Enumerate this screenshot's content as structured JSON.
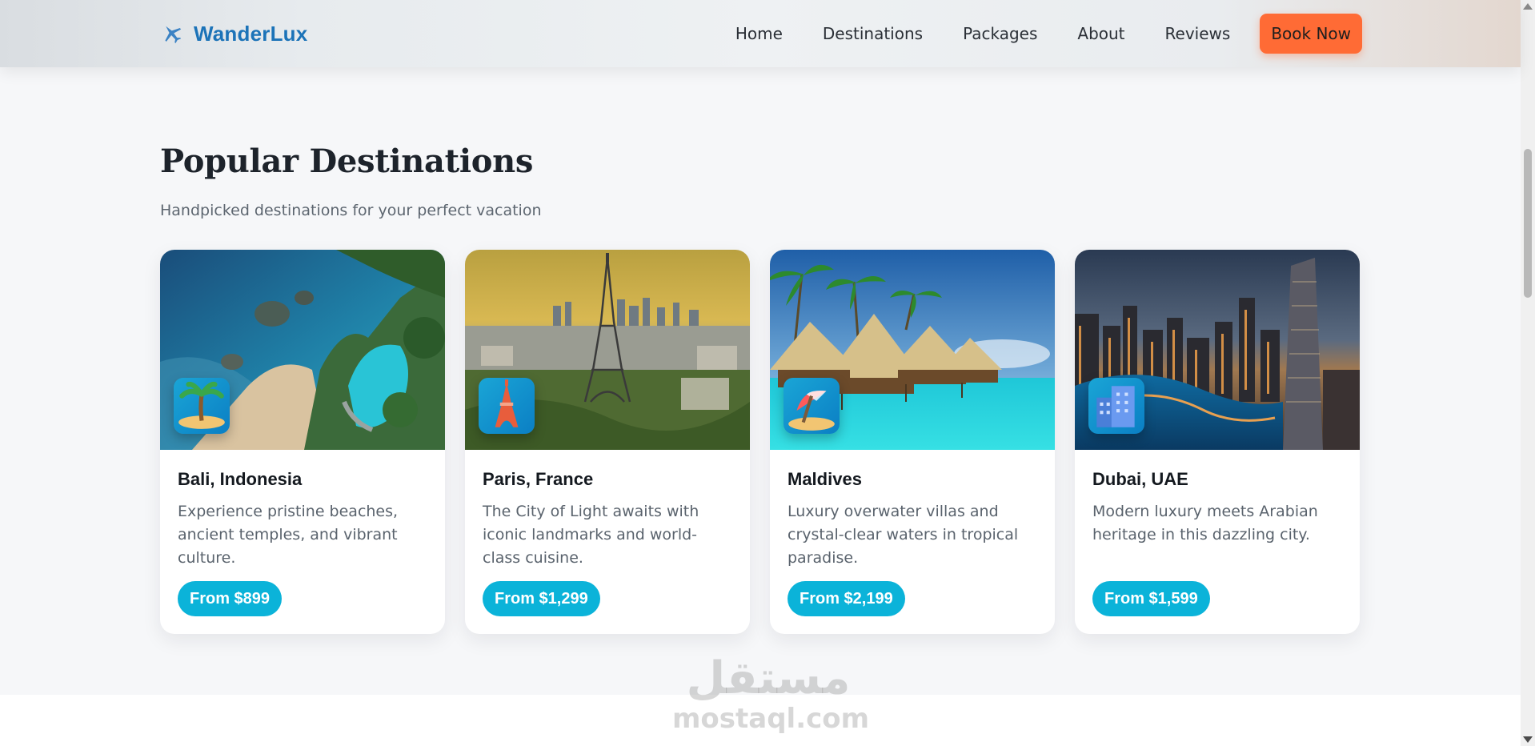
{
  "brand": {
    "name": "WanderLux",
    "icon": "airplane-icon"
  },
  "nav": {
    "links": [
      "Home",
      "Destinations",
      "Packages",
      "About",
      "Reviews"
    ],
    "cta": "Book Now"
  },
  "section": {
    "title": "Popular Destinations",
    "subtitle": "Handpicked destinations for your perfect vacation"
  },
  "destinations": [
    {
      "name": "Bali, Indonesia",
      "description": "Experience pristine beaches, ancient temples, and vibrant culture.",
      "price": "From $899",
      "icon": "desert-island-icon"
    },
    {
      "name": "Paris, France",
      "description": "The City of Light awaits with iconic landmarks and world-class cuisine.",
      "price": "From $1,299",
      "icon": "eiffel-tower-icon"
    },
    {
      "name": "Maldives",
      "description": "Luxury overwater villas and crystal-clear waters in tropical paradise.",
      "price": "From $2,199",
      "icon": "beach-umbrella-icon"
    },
    {
      "name": "Dubai, UAE",
      "description": "Modern luxury meets Arabian heritage in this dazzling city.",
      "price": "From $1,599",
      "icon": "city-building-icon"
    }
  ],
  "watermark": {
    "arabic": "مستقل",
    "latin": "mostaql.com"
  },
  "colors": {
    "brand": "#1c73b8",
    "cta": "#ff6b35",
    "price_pill": "#0bb3d9",
    "badge": "#0b7fc4"
  }
}
